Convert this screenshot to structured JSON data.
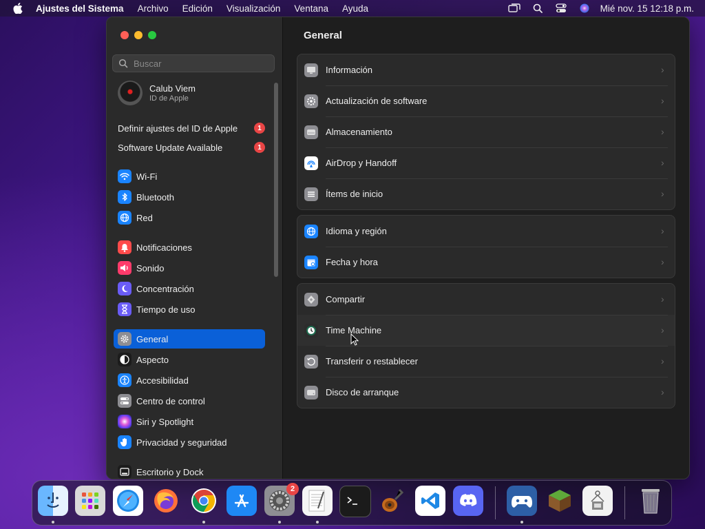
{
  "menubar": {
    "app": "Ajustes del Sistema",
    "items": [
      "Archivo",
      "Edición",
      "Visualización",
      "Ventana",
      "Ayuda"
    ],
    "clock": "Mié nov. 15  12:18 p.m."
  },
  "sidebar": {
    "search_placeholder": "Buscar",
    "account_name": "Calub Viem",
    "account_sub": "ID de Apple",
    "notices": [
      {
        "label": "Definir ajustes del ID de Apple",
        "badge": "1"
      },
      {
        "label": "Software Update Available",
        "badge": "1"
      }
    ],
    "items": [
      {
        "label": "Wi-Fi",
        "icon": "wifi-icon",
        "color": "#1a84ff"
      },
      {
        "label": "Bluetooth",
        "icon": "bluetooth-icon",
        "color": "#1a84ff"
      },
      {
        "label": "Red",
        "icon": "globe-icon",
        "color": "#1a84ff"
      },
      {
        "label": "Notificaciones",
        "icon": "bell-icon",
        "color": "#ff4b4b"
      },
      {
        "label": "Sonido",
        "icon": "speaker-icon",
        "color": "#ff3b6b"
      },
      {
        "label": "Concentración",
        "icon": "moon-icon",
        "color": "#6a5cf6"
      },
      {
        "label": "Tiempo de uso",
        "icon": "hourglass-icon",
        "color": "#6a5cf6"
      },
      {
        "label": "General",
        "icon": "gear-icon",
        "color": "#8e8e93"
      },
      {
        "label": "Aspecto",
        "icon": "appearance-icon",
        "color": "#1c1c1c"
      },
      {
        "label": "Accesibilidad",
        "icon": "accessibility-icon",
        "color": "#1a84ff"
      },
      {
        "label": "Centro de control",
        "icon": "toggles-icon",
        "color": "#8e8e93"
      },
      {
        "label": "Siri y Spotlight",
        "icon": "siri-icon",
        "color": "#9b59b6"
      },
      {
        "label": "Privacidad y seguridad",
        "icon": "hand-icon",
        "color": "#1a84ff"
      },
      {
        "label": "Escritorio y Dock",
        "icon": "dock-icon",
        "color": "#1c1c1c"
      }
    ]
  },
  "main": {
    "title": "General",
    "group1": [
      {
        "label": "Información",
        "icon": "info-icon"
      },
      {
        "label": "Actualización de software",
        "icon": "software-update-icon"
      },
      {
        "label": "Almacenamiento",
        "icon": "storage-icon"
      },
      {
        "label": "AirDrop y Handoff",
        "icon": "airdrop-icon"
      },
      {
        "label": "Ítems de inicio",
        "icon": "login-items-icon"
      }
    ],
    "group2": [
      {
        "label": "Idioma y región",
        "icon": "language-icon"
      },
      {
        "label": "Fecha y hora",
        "icon": "calendar-icon"
      }
    ],
    "group3": [
      {
        "label": "Compartir",
        "icon": "sharing-icon"
      },
      {
        "label": "Time Machine",
        "icon": "time-machine-icon"
      },
      {
        "label": "Transferir o restablecer",
        "icon": "reset-icon"
      },
      {
        "label": "Disco de arranque",
        "icon": "startup-disk-icon"
      }
    ]
  },
  "dock": {
    "system_settings_badge": "2"
  }
}
